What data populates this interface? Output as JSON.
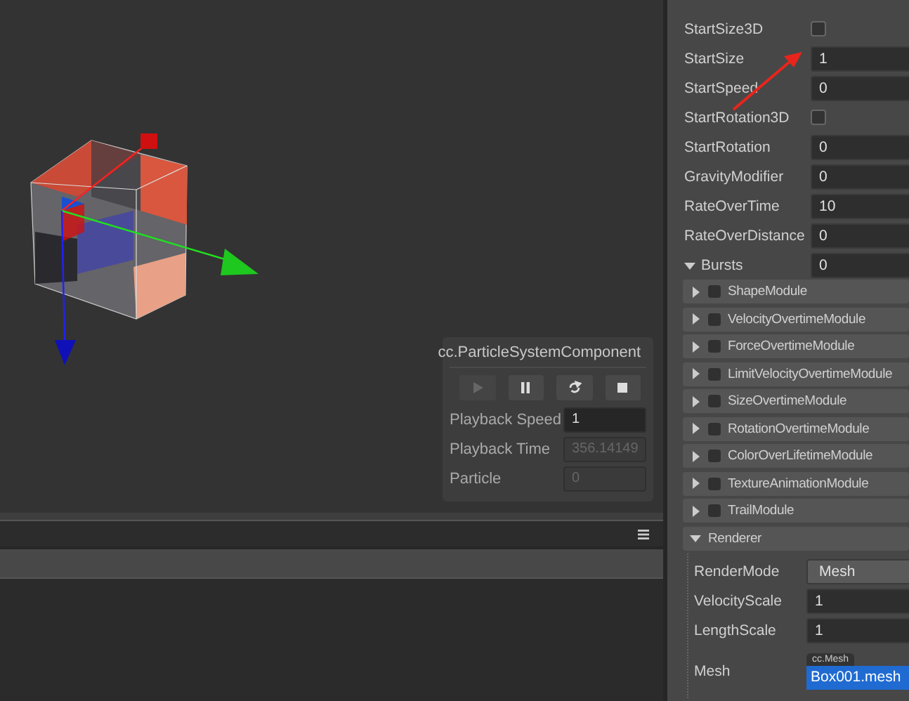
{
  "scene": {
    "component_panel": {
      "title": "cc.ParticleSystemComponent",
      "controls": [
        {
          "kind": "play",
          "disabled": true
        },
        {
          "kind": "pause",
          "disabled": false
        },
        {
          "kind": "restart",
          "disabled": false
        },
        {
          "kind": "stop",
          "disabled": false
        }
      ],
      "fields": [
        {
          "label": "Playback Speed",
          "value": "1",
          "disabled": false
        },
        {
          "label": "Playback Time",
          "value": "356.14149",
          "disabled": true
        },
        {
          "label": "Particle",
          "value": "0",
          "disabled": true
        }
      ]
    }
  },
  "inspector": {
    "properties": [
      {
        "kind": "checkbox",
        "label": "StartSize3D",
        "checked": false
      },
      {
        "kind": "number",
        "label": "StartSize",
        "value": "1"
      },
      {
        "kind": "number",
        "label": "StartSpeed",
        "value": "0"
      },
      {
        "kind": "checkbox",
        "label": "StartRotation3D",
        "checked": false
      },
      {
        "kind": "number",
        "label": "StartRotation",
        "value": "0"
      },
      {
        "kind": "number",
        "label": "GravityModifier",
        "value": "0"
      },
      {
        "kind": "number",
        "label": "RateOverTime",
        "value": "10"
      },
      {
        "kind": "number",
        "label": "RateOverDistance",
        "value": "0"
      },
      {
        "kind": "array",
        "label": "Bursts",
        "value": "0",
        "expanded": true
      }
    ],
    "modules": [
      {
        "label": "ShapeModule",
        "expanded": false,
        "enabled": false
      },
      {
        "label": "VelocityOvertimeModule",
        "expanded": false,
        "enabled": false
      },
      {
        "label": "ForceOvertimeModule",
        "expanded": false,
        "enabled": false
      },
      {
        "label": "LimitVelocityOvertimeModule",
        "expanded": false,
        "enabled": false
      },
      {
        "label": "SizeOvertimeModule",
        "expanded": false,
        "enabled": false
      },
      {
        "label": "RotationOvertimeModule",
        "expanded": false,
        "enabled": false
      },
      {
        "label": "ColorOverLifetimeModule",
        "expanded": false,
        "enabled": false
      },
      {
        "label": "TextureAnimationModule",
        "expanded": false,
        "enabled": false
      },
      {
        "label": "TrailModule",
        "expanded": false,
        "enabled": false
      }
    ],
    "renderer": {
      "label": "Renderer",
      "expanded": true,
      "properties": [
        {
          "kind": "dropdown",
          "label": "RenderMode",
          "value": "Mesh"
        },
        {
          "kind": "number",
          "label": "VelocityScale",
          "value": "1"
        },
        {
          "kind": "number",
          "label": "LengthScale",
          "value": "1"
        },
        {
          "kind": "asset",
          "label": "Mesh",
          "asset_type": "cc.Mesh",
          "value": "Box001.mesh"
        }
      ]
    }
  }
}
